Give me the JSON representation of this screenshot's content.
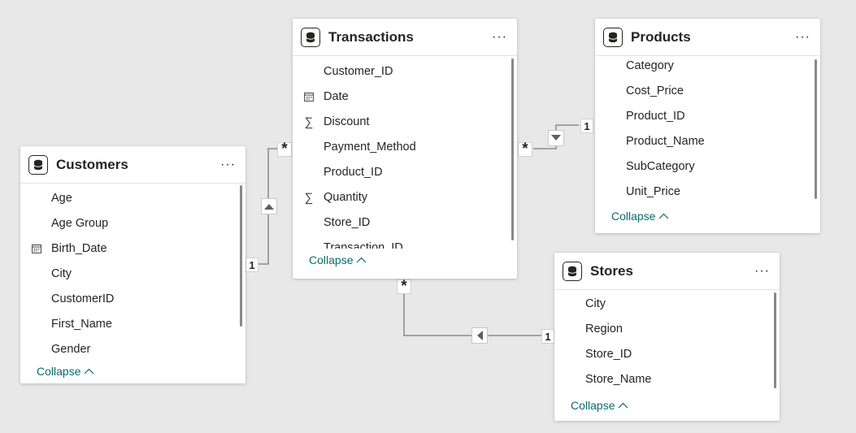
{
  "tables": {
    "transactions": {
      "title": "Transactions",
      "more": "···",
      "fields": [
        "Customer_ID",
        "Date",
        "Discount",
        "Payment_Method",
        "Product_ID",
        "Quantity",
        "Store_ID",
        "Transaction_ID"
      ],
      "collapse": "Collapse"
    },
    "products": {
      "title": "Products",
      "more": "···",
      "fields": [
        "Category",
        "Cost_Price",
        "Product_ID",
        "Product_Name",
        "SubCategory",
        "Unit_Price"
      ],
      "collapse": "Collapse"
    },
    "customers": {
      "title": "Customers",
      "more": "···",
      "fields": [
        "Age",
        "Age Group",
        "Birth_Date",
        "City",
        "CustomerID",
        "First_Name",
        "Gender"
      ],
      "collapse": "Collapse"
    },
    "stores": {
      "title": "Stores",
      "more": "···",
      "fields": [
        "City",
        "Region",
        "Store_ID",
        "Store_Name"
      ],
      "collapse": "Collapse"
    }
  },
  "relationships": {
    "one": "1",
    "many": "*"
  },
  "colors": {
    "background": "#e8e8e8",
    "card": "#ffffff",
    "link": "#0b6a6a",
    "line": "#7a7a7a"
  }
}
